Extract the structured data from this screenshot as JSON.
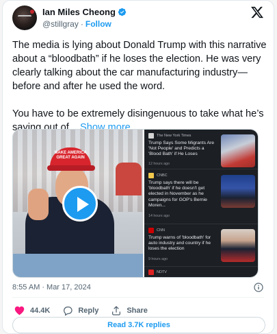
{
  "author": {
    "name": "Ian Miles Cheong",
    "handle": "@stillgray",
    "separator": "·",
    "follow_label": "Follow"
  },
  "tweet": {
    "paragraph1": "The media is lying about Donald Trump with this narrative about a “bloodbath” if he loses the election. He was very clearly talking about the car manufacturing industry—before and after he used the word.",
    "paragraph2": "You have to be extremely disingenuous to take what he’s saying out of... ",
    "show_more": "Show more"
  },
  "media": {
    "hat_text": "MAKE AMERICA GREAT AGAIN",
    "news_items": [
      {
        "source": "The New York Times",
        "headline": "Trump Says Some Migrants Are 'Not People' and Predicts a 'Blood Bath' if He Loses",
        "ago": "12 hours ago"
      },
      {
        "source": "CNBC",
        "headline": "Trump says there will be 'bloodbath' if he doesn't get elected in November as he campaigns for GOP's Bernie Moren...",
        "ago": "14 hours ago"
      },
      {
        "source": "CNN",
        "headline": "Trump warns of 'bloodbath' for auto industry and country if he loses the election",
        "ago": "9 hours ago"
      },
      {
        "source": "NDTV",
        "headline": "",
        "ago": ""
      }
    ]
  },
  "meta": {
    "time": "8:55 AM",
    "separator": "·",
    "date": "Mar 17, 2024"
  },
  "actions": {
    "likes": "44.4K",
    "reply_label": "Reply",
    "share_label": "Share"
  },
  "footer": {
    "read_replies_label": "Read 3.7K replies"
  },
  "colors": {
    "accent": "#1d9bf0",
    "like": "#f91880",
    "text": "#0f1419",
    "muted": "#536471"
  }
}
